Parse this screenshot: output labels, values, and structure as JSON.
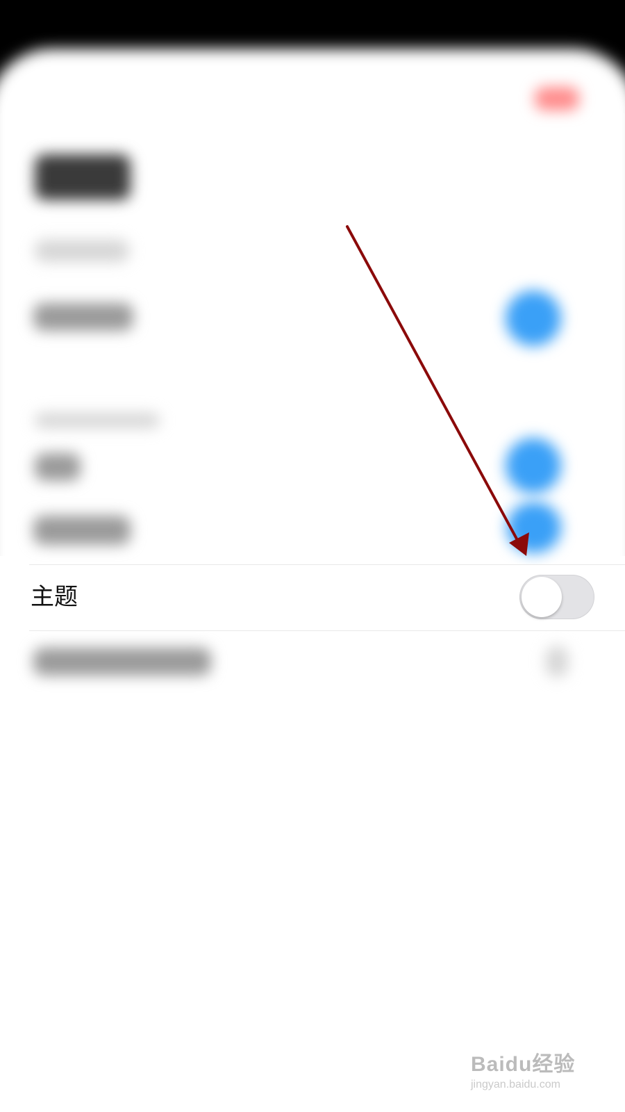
{
  "settings": {
    "theme_row": {
      "label": "主题",
      "toggle_on": false
    }
  },
  "annotation": {
    "arrow_color": "#8b0a0a"
  },
  "watermark": {
    "logo_text": "Baidu经验",
    "url": "jingyan.baidu.com"
  },
  "colors": {
    "toggle_off_track": "#e3e3e6",
    "accent_blue": "#3aa0f7",
    "accent_red": "#ff8c8c"
  }
}
